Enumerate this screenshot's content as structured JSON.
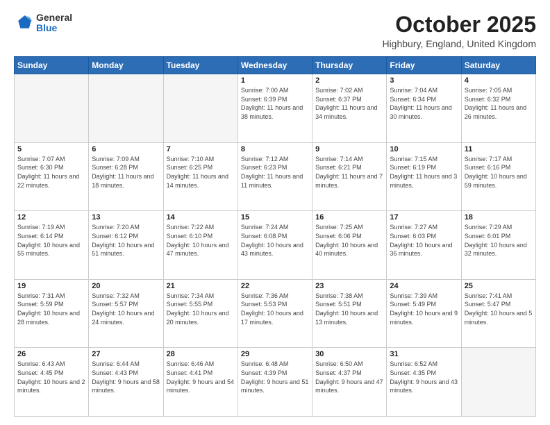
{
  "header": {
    "logo_general": "General",
    "logo_blue": "Blue",
    "month_title": "October 2025",
    "location": "Highbury, England, United Kingdom"
  },
  "days_of_week": [
    "Sunday",
    "Monday",
    "Tuesday",
    "Wednesday",
    "Thursday",
    "Friday",
    "Saturday"
  ],
  "weeks": [
    [
      {
        "day": "",
        "info": ""
      },
      {
        "day": "",
        "info": ""
      },
      {
        "day": "",
        "info": ""
      },
      {
        "day": "1",
        "info": "Sunrise: 7:00 AM\nSunset: 6:39 PM\nDaylight: 11 hours\nand 38 minutes."
      },
      {
        "day": "2",
        "info": "Sunrise: 7:02 AM\nSunset: 6:37 PM\nDaylight: 11 hours\nand 34 minutes."
      },
      {
        "day": "3",
        "info": "Sunrise: 7:04 AM\nSunset: 6:34 PM\nDaylight: 11 hours\nand 30 minutes."
      },
      {
        "day": "4",
        "info": "Sunrise: 7:05 AM\nSunset: 6:32 PM\nDaylight: 11 hours\nand 26 minutes."
      }
    ],
    [
      {
        "day": "5",
        "info": "Sunrise: 7:07 AM\nSunset: 6:30 PM\nDaylight: 11 hours\nand 22 minutes."
      },
      {
        "day": "6",
        "info": "Sunrise: 7:09 AM\nSunset: 6:28 PM\nDaylight: 11 hours\nand 18 minutes."
      },
      {
        "day": "7",
        "info": "Sunrise: 7:10 AM\nSunset: 6:25 PM\nDaylight: 11 hours\nand 14 minutes."
      },
      {
        "day": "8",
        "info": "Sunrise: 7:12 AM\nSunset: 6:23 PM\nDaylight: 11 hours\nand 11 minutes."
      },
      {
        "day": "9",
        "info": "Sunrise: 7:14 AM\nSunset: 6:21 PM\nDaylight: 11 hours\nand 7 minutes."
      },
      {
        "day": "10",
        "info": "Sunrise: 7:15 AM\nSunset: 6:19 PM\nDaylight: 11 hours\nand 3 minutes."
      },
      {
        "day": "11",
        "info": "Sunrise: 7:17 AM\nSunset: 6:16 PM\nDaylight: 10 hours\nand 59 minutes."
      }
    ],
    [
      {
        "day": "12",
        "info": "Sunrise: 7:19 AM\nSunset: 6:14 PM\nDaylight: 10 hours\nand 55 minutes."
      },
      {
        "day": "13",
        "info": "Sunrise: 7:20 AM\nSunset: 6:12 PM\nDaylight: 10 hours\nand 51 minutes."
      },
      {
        "day": "14",
        "info": "Sunrise: 7:22 AM\nSunset: 6:10 PM\nDaylight: 10 hours\nand 47 minutes."
      },
      {
        "day": "15",
        "info": "Sunrise: 7:24 AM\nSunset: 6:08 PM\nDaylight: 10 hours\nand 43 minutes."
      },
      {
        "day": "16",
        "info": "Sunrise: 7:25 AM\nSunset: 6:06 PM\nDaylight: 10 hours\nand 40 minutes."
      },
      {
        "day": "17",
        "info": "Sunrise: 7:27 AM\nSunset: 6:03 PM\nDaylight: 10 hours\nand 36 minutes."
      },
      {
        "day": "18",
        "info": "Sunrise: 7:29 AM\nSunset: 6:01 PM\nDaylight: 10 hours\nand 32 minutes."
      }
    ],
    [
      {
        "day": "19",
        "info": "Sunrise: 7:31 AM\nSunset: 5:59 PM\nDaylight: 10 hours\nand 28 minutes."
      },
      {
        "day": "20",
        "info": "Sunrise: 7:32 AM\nSunset: 5:57 PM\nDaylight: 10 hours\nand 24 minutes."
      },
      {
        "day": "21",
        "info": "Sunrise: 7:34 AM\nSunset: 5:55 PM\nDaylight: 10 hours\nand 20 minutes."
      },
      {
        "day": "22",
        "info": "Sunrise: 7:36 AM\nSunset: 5:53 PM\nDaylight: 10 hours\nand 17 minutes."
      },
      {
        "day": "23",
        "info": "Sunrise: 7:38 AM\nSunset: 5:51 PM\nDaylight: 10 hours\nand 13 minutes."
      },
      {
        "day": "24",
        "info": "Sunrise: 7:39 AM\nSunset: 5:49 PM\nDaylight: 10 hours\nand 9 minutes."
      },
      {
        "day": "25",
        "info": "Sunrise: 7:41 AM\nSunset: 5:47 PM\nDaylight: 10 hours\nand 5 minutes."
      }
    ],
    [
      {
        "day": "26",
        "info": "Sunrise: 6:43 AM\nSunset: 4:45 PM\nDaylight: 10 hours\nand 2 minutes."
      },
      {
        "day": "27",
        "info": "Sunrise: 6:44 AM\nSunset: 4:43 PM\nDaylight: 9 hours\nand 58 minutes."
      },
      {
        "day": "28",
        "info": "Sunrise: 6:46 AM\nSunset: 4:41 PM\nDaylight: 9 hours\nand 54 minutes."
      },
      {
        "day": "29",
        "info": "Sunrise: 6:48 AM\nSunset: 4:39 PM\nDaylight: 9 hours\nand 51 minutes."
      },
      {
        "day": "30",
        "info": "Sunrise: 6:50 AM\nSunset: 4:37 PM\nDaylight: 9 hours\nand 47 minutes."
      },
      {
        "day": "31",
        "info": "Sunrise: 6:52 AM\nSunset: 4:35 PM\nDaylight: 9 hours\nand 43 minutes."
      },
      {
        "day": "",
        "info": ""
      }
    ]
  ]
}
